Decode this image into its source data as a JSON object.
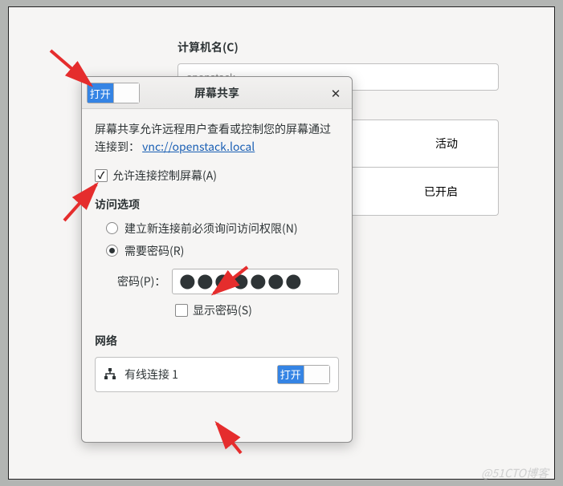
{
  "background": {
    "computer_name_label": "计算机名(C)",
    "computer_name_value": "openstack",
    "status_active": "活动",
    "status_enabled": "已开启"
  },
  "dialog": {
    "toggle_on_label": "打开",
    "title": "屏幕共享",
    "close_glyph": "✕",
    "desc_prefix": "屏幕共享允许远程用户查看或控制您的屏幕通过连接到：",
    "vnc_url": "vnc://openstack.local",
    "allow_control_label": "允许连接控制屏幕(A)",
    "access_section_title": "访问选项",
    "radio_ask_label": "建立新连接前必须询问访问权限(N)",
    "radio_password_label": "需要密码(R)",
    "password_label": "密码(P)：",
    "password_masked": "●●●●●●●",
    "show_password_label": "显示密码(S)",
    "network_section_title": "网络",
    "network_item_name": "有线连接 1",
    "network_toggle_label": "打开"
  },
  "watermark": "@51CTO博客",
  "arrow_color": "#e52d2d"
}
